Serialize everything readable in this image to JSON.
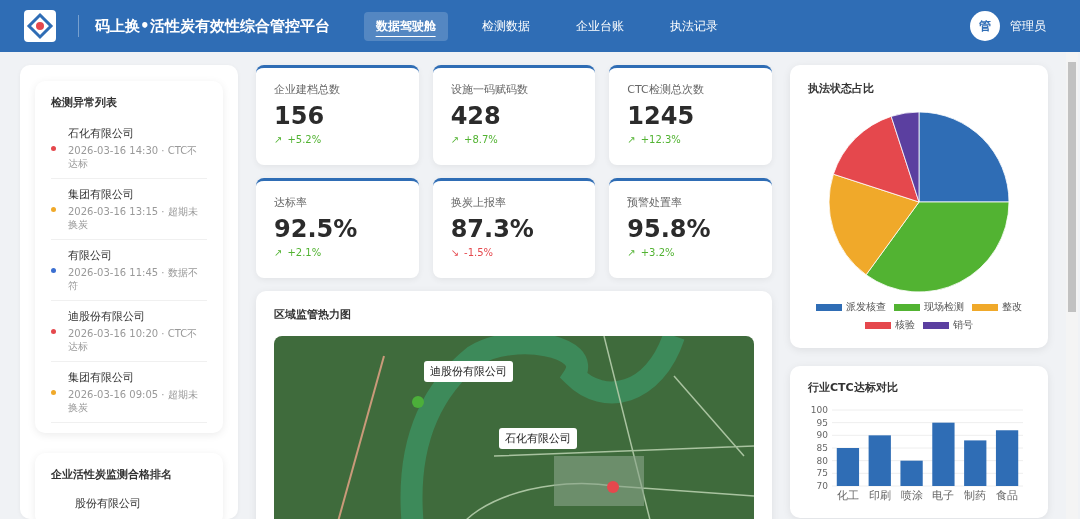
{
  "header": {
    "title": "码上换•活性炭有效性综合管控平台",
    "nav": [
      {
        "label": "数据驾驶舱",
        "selected": true
      },
      {
        "label": "检测数据",
        "selected": false
      },
      {
        "label": "企业台账",
        "selected": false
      },
      {
        "label": "执法记录",
        "selected": false
      }
    ],
    "avatar": "管",
    "user": "管理员"
  },
  "anomaly_list": {
    "title": "检测异常列表",
    "items": [
      {
        "company": "石化有限公司",
        "meta": "2026-03-16 14:30 · CTC不达标",
        "color": "#e5484d"
      },
      {
        "company": "集团有限公司",
        "meta": "2026-03-16 13:15 · 超期未换炭",
        "color": "#f0a92a"
      },
      {
        "company": "有限公司",
        "meta": "2026-03-16 11:45 · 数据不符",
        "color": "#3b6fd1"
      },
      {
        "company": "迪股份有限公司",
        "meta": "2026-03-16 10:20 · CTC不达标",
        "color": "#e5484d"
      },
      {
        "company": "集团有限公司",
        "meta": "2026-03-16 09:05 · 超期未换炭",
        "color": "#f0a92a"
      }
    ]
  },
  "ranking": {
    "title": "企业活性炭监测合格排名",
    "items": [
      {
        "company": "股份有限公司"
      }
    ]
  },
  "stats": [
    {
      "label": "企业建档总数",
      "value": "156",
      "positive": true,
      "arrow": "↗",
      "change": "+5.2%"
    },
    {
      "label": "设施一码赋码数",
      "value": "428",
      "positive": true,
      "arrow": "↗",
      "change": "+8.7%"
    },
    {
      "label": "CTC检测总次数",
      "value": "1245",
      "positive": true,
      "arrow": "↗",
      "change": "+12.3%"
    },
    {
      "label": "达标率",
      "value": "92.5%",
      "positive": true,
      "arrow": "↗",
      "change": "+2.1%"
    },
    {
      "label": "换炭上报率",
      "value": "87.3%",
      "positive": false,
      "arrow": "↘",
      "change": "-1.5%"
    },
    {
      "label": "预警处置率",
      "value": "95.8%",
      "positive": true,
      "arrow": "↗",
      "change": "+3.2%"
    }
  ],
  "map": {
    "title": "区域监管热力图",
    "markers": [
      {
        "label": "迪股份有限公司",
        "color": "#4caf3a"
      },
      {
        "label": "石化有限公司",
        "color": "#e5484d"
      }
    ]
  },
  "pie": {
    "title": "执法状态占比",
    "chart_data": {
      "type": "pie",
      "categories": [
        "派发核查",
        "现场检测",
        "整改",
        "核验",
        "销号"
      ],
      "series": [
        {
          "values": [
            25,
            35,
            20,
            15,
            5
          ]
        }
      ],
      "colors": [
        "#2f6db5",
        "#52b332",
        "#f0a92a",
        "#e5484d",
        "#5b3fa0"
      ]
    }
  },
  "bar": {
    "title": "行业CTC达标对比",
    "chart_data": {
      "type": "bar",
      "categories": [
        "化工",
        "印刷",
        "喷涂",
        "电子",
        "制药",
        "食品"
      ],
      "series": [
        {
          "color": "#2f6db5",
          "values": [
            85,
            90,
            80,
            95,
            88,
            92
          ]
        }
      ],
      "grid": true,
      "ylim": [
        70,
        100
      ],
      "yticks": [
        70,
        75,
        80,
        85,
        90,
        95,
        100
      ]
    }
  }
}
